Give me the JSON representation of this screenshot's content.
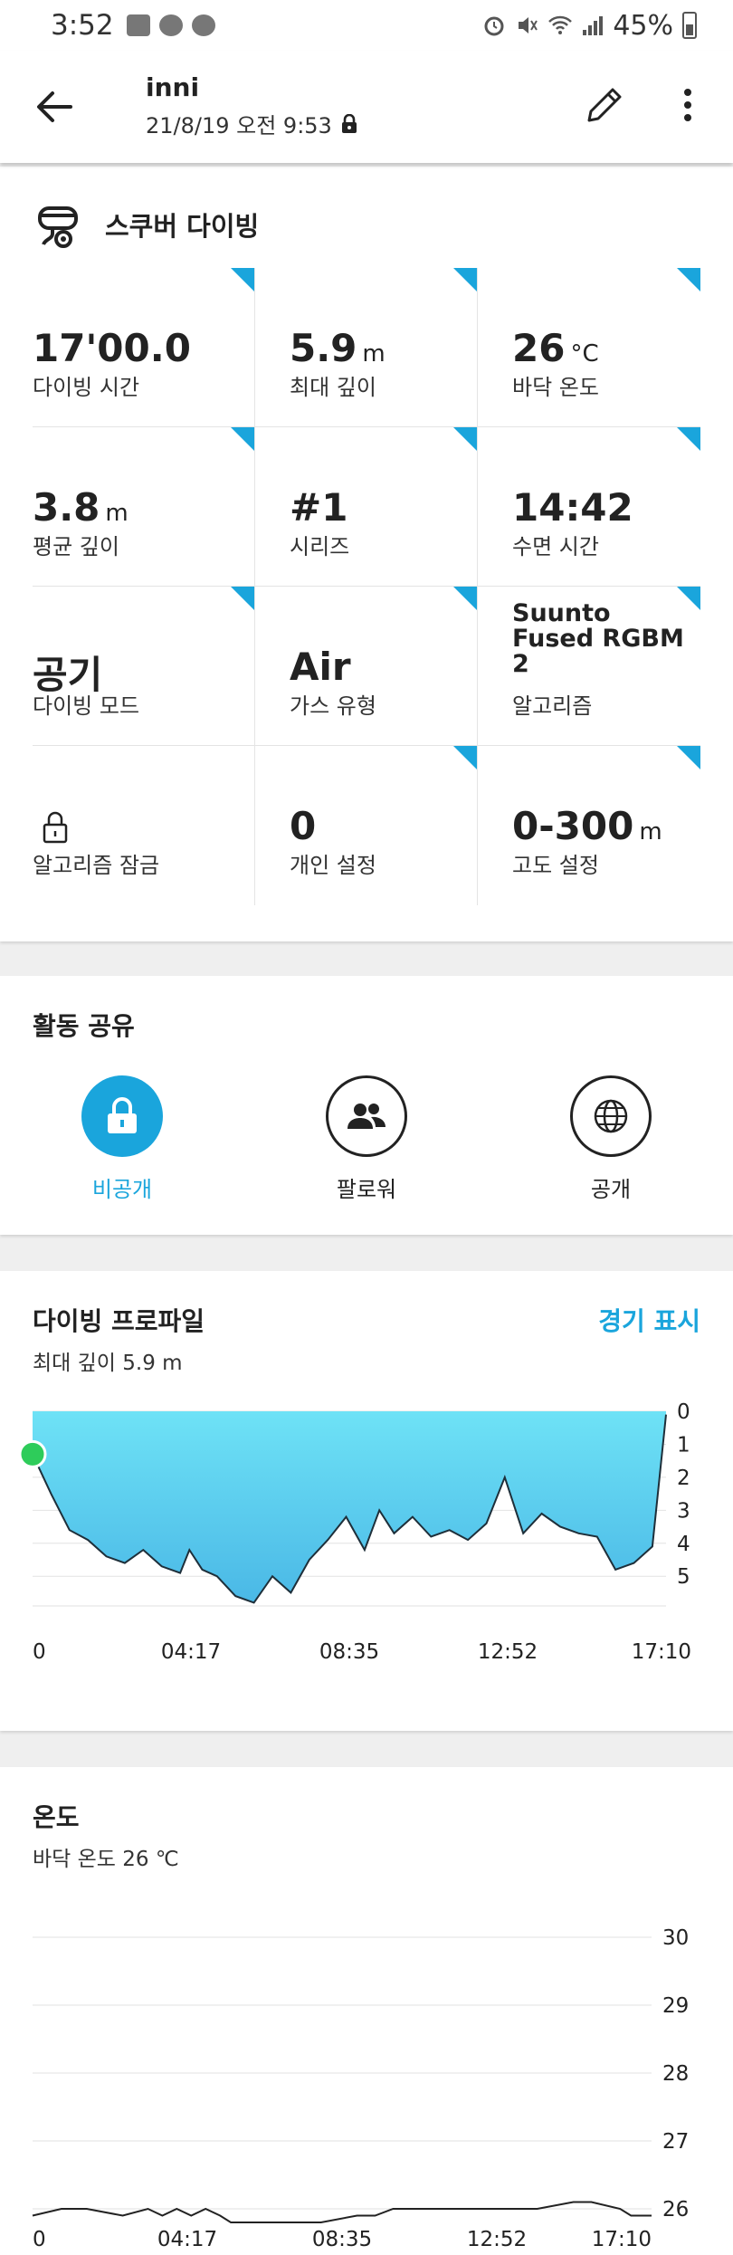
{
  "status_bar": {
    "time": "3:52",
    "battery": "45%"
  },
  "app_bar": {
    "title": "inni",
    "subtitle": "21/8/19 오전 9:53"
  },
  "summary": {
    "activity": "스쿠버 다이빙",
    "cells": [
      {
        "value": "17'00.0",
        "unit": "",
        "label": "다이빙 시간"
      },
      {
        "value": "5.9",
        "unit": "m",
        "label": "최대 깊이"
      },
      {
        "value": "26",
        "unit": "°C",
        "label": "바닥 온도"
      },
      {
        "value": "3.8",
        "unit": "m",
        "label": "평균 깊이"
      },
      {
        "value": "#1",
        "unit": "",
        "label": "시리즈"
      },
      {
        "value": "14:42",
        "unit": "",
        "label": "수면 시간"
      },
      {
        "value": "공기",
        "unit": "",
        "label": "다이빙 모드"
      },
      {
        "value": "Air",
        "unit": "",
        "label": "가스 유형"
      },
      {
        "value": "Suunto Fused RGBM 2",
        "unit": "",
        "label": "알고리즘"
      },
      {
        "value": "",
        "unit": "",
        "label": "알고리즘 잠금"
      },
      {
        "value": "0",
        "unit": "",
        "label": "개인 설정"
      },
      {
        "value": "0-300",
        "unit": "m",
        "label": "고도 설정"
      }
    ]
  },
  "share": {
    "title": "활동 공유",
    "options": [
      {
        "label": "비공개",
        "icon": "lock-icon",
        "selected": true
      },
      {
        "label": "팔로워",
        "icon": "followers-icon",
        "selected": false
      },
      {
        "label": "공개",
        "icon": "globe-icon",
        "selected": false
      }
    ]
  },
  "dive_profile": {
    "title": "다이빙 프로파일",
    "subtitle": "최대 깊이 5.9 m",
    "link": "경기 표시"
  },
  "temperature": {
    "title": "온도",
    "subtitle": "바닥 온도 26 ℃"
  },
  "colors": {
    "accent": "#1aa5dc",
    "profile_fill_top": "#6ee2f6",
    "profile_fill_bottom": "#4ab8e6",
    "marker": "#2ecc5a"
  },
  "chart_data": [
    {
      "type": "area",
      "title": "다이빙 프로파일",
      "xlabel": "",
      "ylabel": "",
      "x_ticks": [
        "0",
        "04:17",
        "08:35",
        "12:52",
        "17:10"
      ],
      "y_ticks": [
        "0",
        "1",
        "2",
        "3",
        "4",
        "5"
      ],
      "ylim": [
        0,
        5.9
      ],
      "y_inverted": true,
      "grid": true,
      "x_minutes": [
        0,
        0.5,
        1,
        1.5,
        2,
        2.5,
        3,
        3.5,
        4,
        4.25,
        4.6,
        5,
        5.5,
        6,
        6.5,
        7,
        7.5,
        8,
        8.5,
        9,
        9.4,
        9.8,
        10.3,
        10.8,
        11.3,
        11.8,
        12.3,
        12.8,
        13.3,
        13.8,
        14.3,
        14.8,
        15.3,
        15.8,
        16.3,
        16.8,
        17.17
      ],
      "depth_m": [
        1.3,
        2.5,
        3.6,
        3.9,
        4.4,
        4.6,
        4.2,
        4.7,
        4.9,
        4.2,
        4.8,
        5.0,
        5.6,
        5.8,
        5.0,
        5.5,
        4.5,
        3.9,
        3.2,
        4.2,
        3.0,
        3.7,
        3.2,
        3.8,
        3.6,
        3.9,
        3.4,
        2.0,
        3.7,
        3.1,
        3.5,
        3.7,
        3.8,
        4.8,
        4.6,
        4.1,
        0.1
      ]
    },
    {
      "type": "line",
      "title": "온도",
      "xlabel": "",
      "ylabel": "",
      "x_ticks": [
        "0",
        "04:17",
        "08:35",
        "12:52",
        "17:10"
      ],
      "y_ticks": [
        "30",
        "29",
        "28",
        "27",
        "26"
      ],
      "ylim": [
        25.8,
        30
      ],
      "grid": true,
      "x_minutes": [
        0,
        0.8,
        1.5,
        2.5,
        3.2,
        3.6,
        4.0,
        4.4,
        4.8,
        5.2,
        5.5,
        6.0,
        7.0,
        8.0,
        9.0,
        9.5,
        10.0,
        11.0,
        12.0,
        13.0,
        14.0,
        15.0,
        15.5,
        16.3,
        16.6,
        17.17
      ],
      "temp_c": [
        25.9,
        26.0,
        26.0,
        25.9,
        26.0,
        25.9,
        26.0,
        25.9,
        26.0,
        25.9,
        25.8,
        25.8,
        25.8,
        25.8,
        25.9,
        25.9,
        26.0,
        26.0,
        26.0,
        26.0,
        26.0,
        26.1,
        26.1,
        26.0,
        25.9,
        25.9
      ]
    }
  ]
}
